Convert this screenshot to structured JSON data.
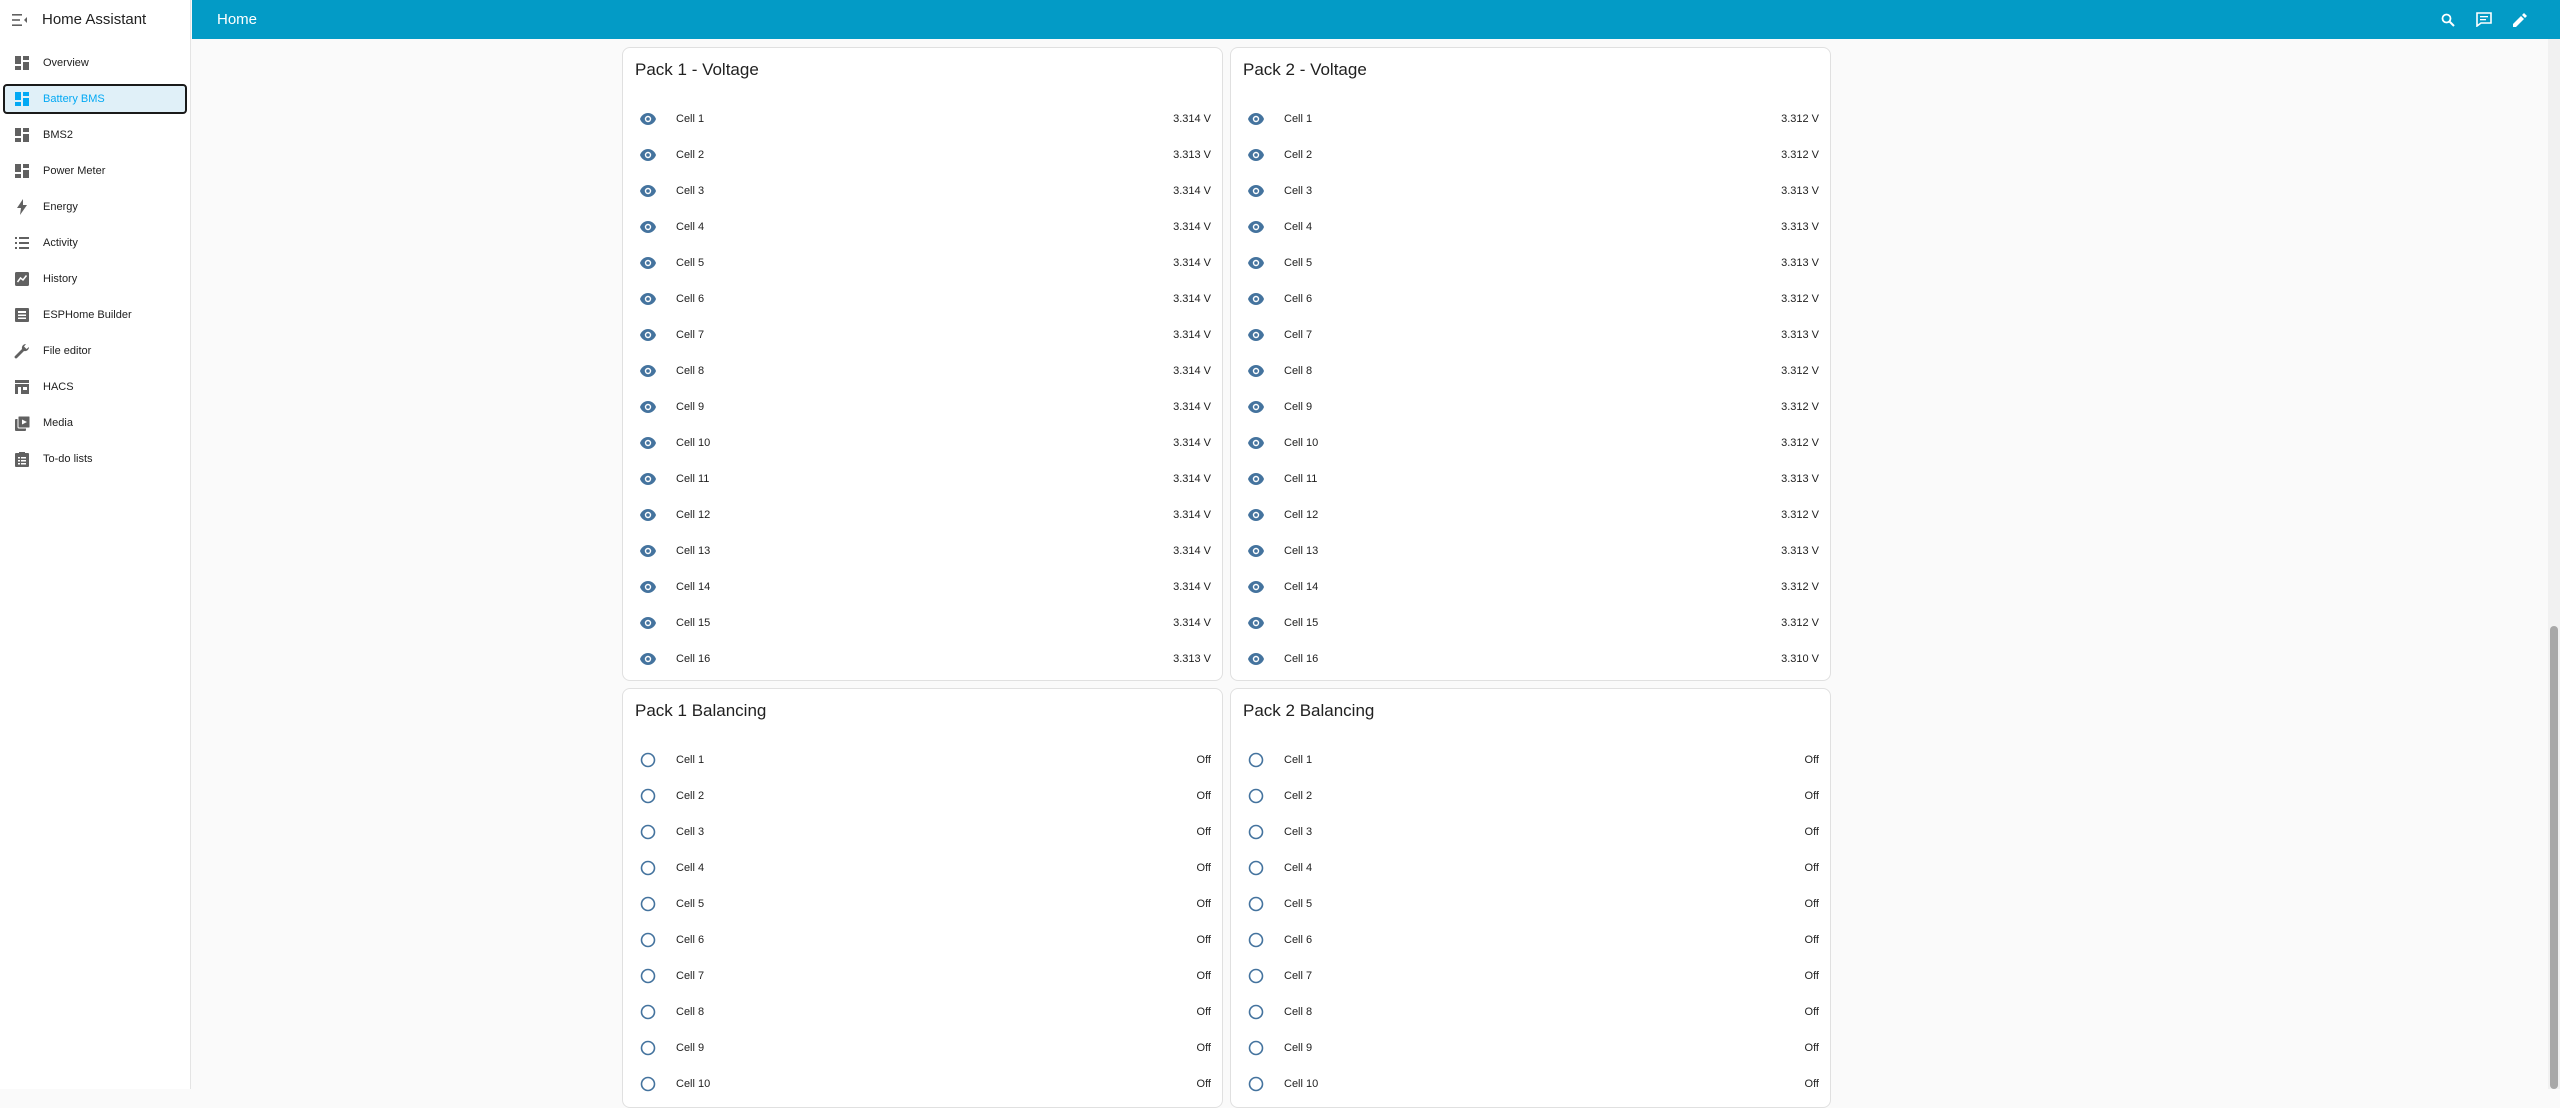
{
  "app": {
    "title": "Home Assistant"
  },
  "header": {
    "title": "Home"
  },
  "sidebar": {
    "items": [
      {
        "label": "Overview",
        "icon": "dashboard-icon"
      },
      {
        "label": "Battery BMS",
        "icon": "dashboard-icon",
        "active": true
      },
      {
        "label": "BMS2",
        "icon": "dashboard-icon"
      },
      {
        "label": "Power Meter",
        "icon": "dashboard-icon"
      },
      {
        "label": "Energy",
        "icon": "lightning-icon"
      },
      {
        "label": "Activity",
        "icon": "list-icon"
      },
      {
        "label": "History",
        "icon": "chart-box-icon"
      },
      {
        "label": "ESPHome Builder",
        "icon": "esphome-icon"
      },
      {
        "label": "File editor",
        "icon": "wrench-icon"
      },
      {
        "label": "HACS",
        "icon": "store-icon"
      },
      {
        "label": "Media",
        "icon": "media-icon"
      },
      {
        "label": "To-do lists",
        "icon": "clipboard-list-icon"
      }
    ]
  },
  "cards": [
    {
      "title": "Pack 1 - Voltage",
      "rows": [
        {
          "name": "Cell 1",
          "value": "3.314 V"
        },
        {
          "name": "Cell 2",
          "value": "3.313 V"
        },
        {
          "name": "Cell 3",
          "value": "3.314 V"
        },
        {
          "name": "Cell 4",
          "value": "3.314 V"
        },
        {
          "name": "Cell 5",
          "value": "3.314 V"
        },
        {
          "name": "Cell 6",
          "value": "3.314 V"
        },
        {
          "name": "Cell 7",
          "value": "3.314 V"
        },
        {
          "name": "Cell 8",
          "value": "3.314 V"
        },
        {
          "name": "Cell 9",
          "value": "3.314 V"
        },
        {
          "name": "Cell 10",
          "value": "3.314 V"
        },
        {
          "name": "Cell 11",
          "value": "3.314 V"
        },
        {
          "name": "Cell 12",
          "value": "3.314 V"
        },
        {
          "name": "Cell 13",
          "value": "3.314 V"
        },
        {
          "name": "Cell 14",
          "value": "3.314 V"
        },
        {
          "name": "Cell 15",
          "value": "3.314 V"
        },
        {
          "name": "Cell 16",
          "value": "3.313 V"
        }
      ]
    },
    {
      "title": "Pack 2 - Voltage",
      "rows": [
        {
          "name": "Cell 1",
          "value": "3.312 V"
        },
        {
          "name": "Cell 2",
          "value": "3.312 V"
        },
        {
          "name": "Cell 3",
          "value": "3.313 V"
        },
        {
          "name": "Cell 4",
          "value": "3.313 V"
        },
        {
          "name": "Cell 5",
          "value": "3.313 V"
        },
        {
          "name": "Cell 6",
          "value": "3.312 V"
        },
        {
          "name": "Cell 7",
          "value": "3.313 V"
        },
        {
          "name": "Cell 8",
          "value": "3.312 V"
        },
        {
          "name": "Cell 9",
          "value": "3.312 V"
        },
        {
          "name": "Cell 10",
          "value": "3.312 V"
        },
        {
          "name": "Cell 11",
          "value": "3.313 V"
        },
        {
          "name": "Cell 12",
          "value": "3.312 V"
        },
        {
          "name": "Cell 13",
          "value": "3.313 V"
        },
        {
          "name": "Cell 14",
          "value": "3.312 V"
        },
        {
          "name": "Cell 15",
          "value": "3.312 V"
        },
        {
          "name": "Cell 16",
          "value": "3.310 V"
        }
      ]
    },
    {
      "title": "Pack 1 Balancing",
      "rows": [
        {
          "name": "Cell 1",
          "value": "Off"
        },
        {
          "name": "Cell 2",
          "value": "Off"
        },
        {
          "name": "Cell 3",
          "value": "Off"
        },
        {
          "name": "Cell 4",
          "value": "Off"
        },
        {
          "name": "Cell 5",
          "value": "Off"
        },
        {
          "name": "Cell 6",
          "value": "Off"
        },
        {
          "name": "Cell 7",
          "value": "Off"
        },
        {
          "name": "Cell 8",
          "value": "Off"
        },
        {
          "name": "Cell 9",
          "value": "Off"
        },
        {
          "name": "Cell 10",
          "value": "Off"
        }
      ]
    },
    {
      "title": "Pack 2 Balancing",
      "rows": [
        {
          "name": "Cell 1",
          "value": "Off"
        },
        {
          "name": "Cell 2",
          "value": "Off"
        },
        {
          "name": "Cell 3",
          "value": "Off"
        },
        {
          "name": "Cell 4",
          "value": "Off"
        },
        {
          "name": "Cell 5",
          "value": "Off"
        },
        {
          "name": "Cell 6",
          "value": "Off"
        },
        {
          "name": "Cell 7",
          "value": "Off"
        },
        {
          "name": "Cell 8",
          "value": "Off"
        },
        {
          "name": "Cell 9",
          "value": "Off"
        },
        {
          "name": "Cell 10",
          "value": "Off"
        }
      ]
    }
  ],
  "colors": {
    "header": "#039bc6",
    "accent": "#03a9f4",
    "icon": "#44739e"
  }
}
